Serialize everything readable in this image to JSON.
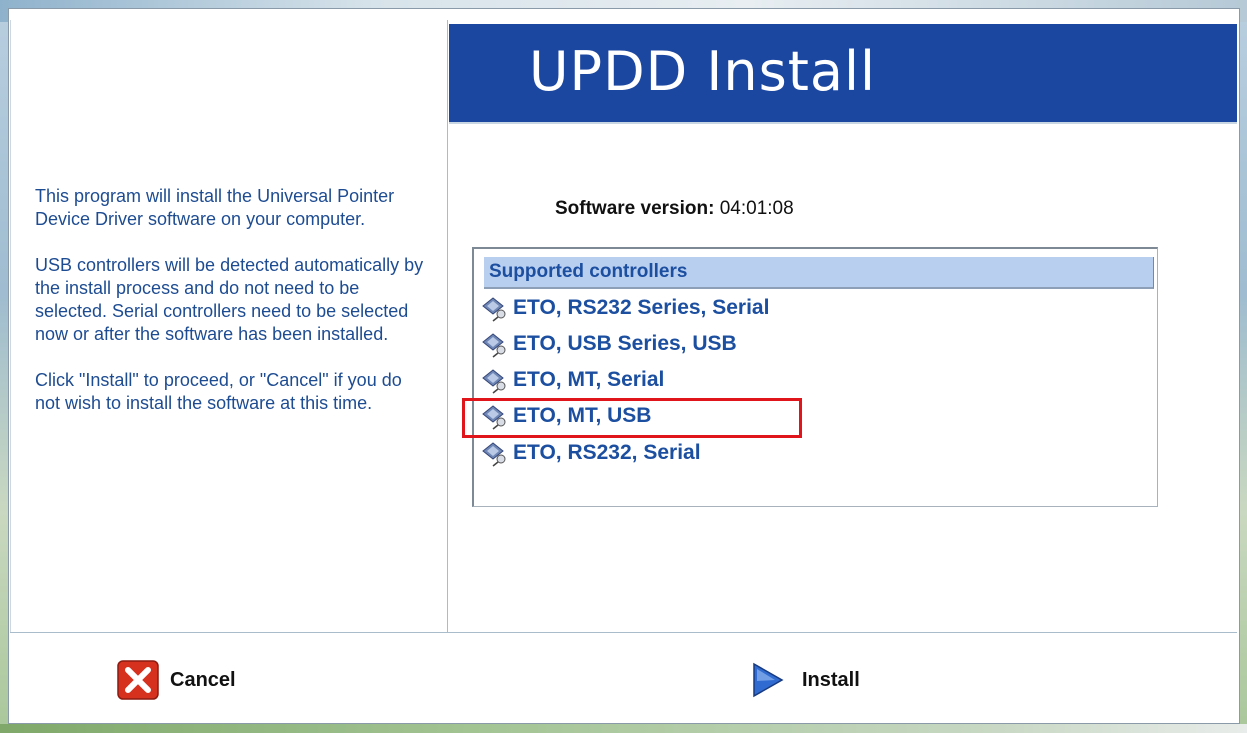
{
  "window": {
    "title": "UPDD Install"
  },
  "intro": {
    "paragraph1": "This program will install the Universal Pointer Device Driver software on your computer.",
    "paragraph2": "USB controllers will be detected automatically by the install process and do not need to be selected. Serial controllers need to be selected now or after the software has been installed.",
    "paragraph3": "Click \"Install\" to proceed, or \"Cancel\" if you do not wish to install the software at this time."
  },
  "version": {
    "label": "Software version:",
    "value": "04:01:08"
  },
  "controllers": {
    "header": "Supported controllers",
    "items": [
      {
        "label": "ETO, RS232 Series, Serial",
        "icon": "controller-plug-icon"
      },
      {
        "label": "ETO, USB Series, USB",
        "icon": "controller-plug-icon"
      },
      {
        "label": "ETO, MT, Serial",
        "icon": "controller-plug-icon"
      },
      {
        "label": "ETO, MT, USB",
        "icon": "controller-plug-icon",
        "highlighted": true
      },
      {
        "label": "ETO, RS232, Serial",
        "icon": "controller-plug-icon"
      }
    ]
  },
  "buttons": {
    "cancel_label": "Cancel",
    "install_label": "Install"
  },
  "colors": {
    "header_bg": "#1c47a1",
    "accent_text": "#1c4fa0",
    "highlight_box": "#e0141b"
  }
}
